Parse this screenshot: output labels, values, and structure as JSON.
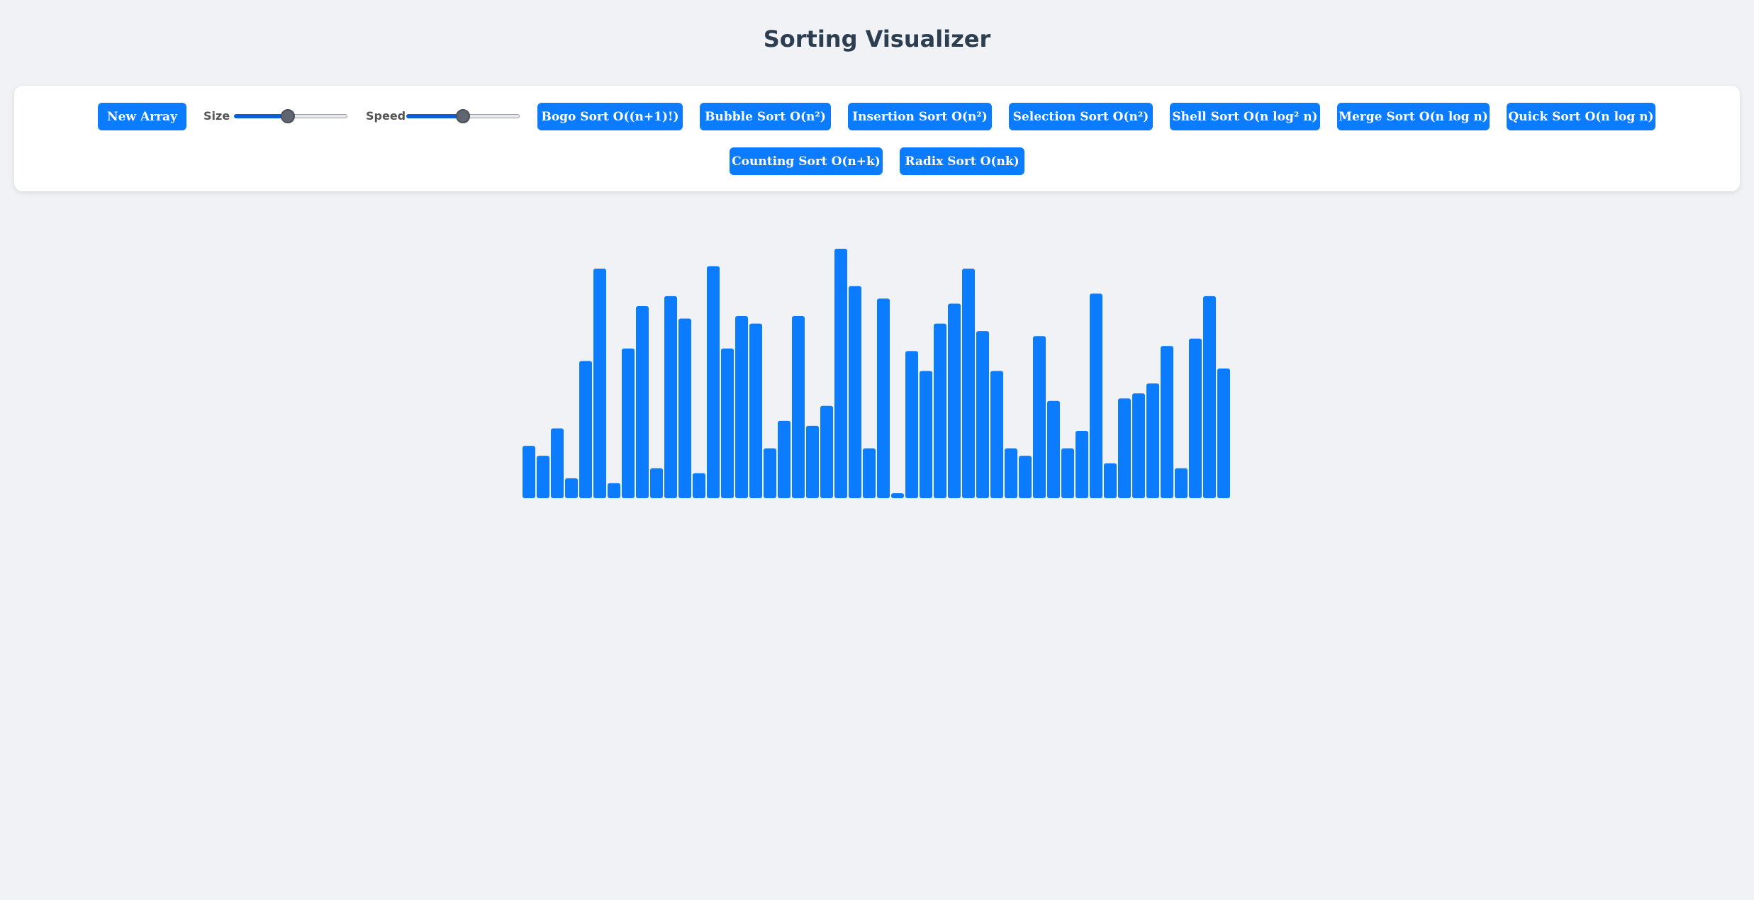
{
  "header": {
    "title": "Sorting Visualizer"
  },
  "controls": {
    "new_array_label": "New Array",
    "size_label": "Size",
    "size_value": 0.47,
    "speed_label": "Speed",
    "speed_value": 0.5
  },
  "algorithms": [
    "Bogo Sort O((n+1)!)",
    "Bubble Sort O(n²)",
    "Insertion Sort O(n²)",
    "Selection Sort O(n²)",
    "Shell Sort O(n log² n)",
    "Merge Sort O(n log n)",
    "Quick Sort O(n log n)",
    "Counting Sort O(n+k)",
    "Radix Sort O(nk)"
  ],
  "array": {
    "max_value": 100,
    "bar_color": "#0b7bff",
    "values": [
      21,
      17,
      28,
      8,
      55,
      92,
      6,
      60,
      77,
      12,
      81,
      72,
      10,
      93,
      60,
      73,
      70,
      20,
      31,
      73,
      29,
      37,
      100,
      85,
      20,
      80,
      2,
      59,
      51,
      70,
      78,
      92,
      67,
      51,
      20,
      17,
      65,
      39,
      20,
      27,
      82,
      14,
      40,
      42,
      46,
      61,
      12,
      64,
      81,
      52
    ]
  },
  "colors": {
    "accent": "#0b7bff",
    "background": "#f0f2f5",
    "panel": "#ffffff",
    "title": "#2c3e50"
  }
}
